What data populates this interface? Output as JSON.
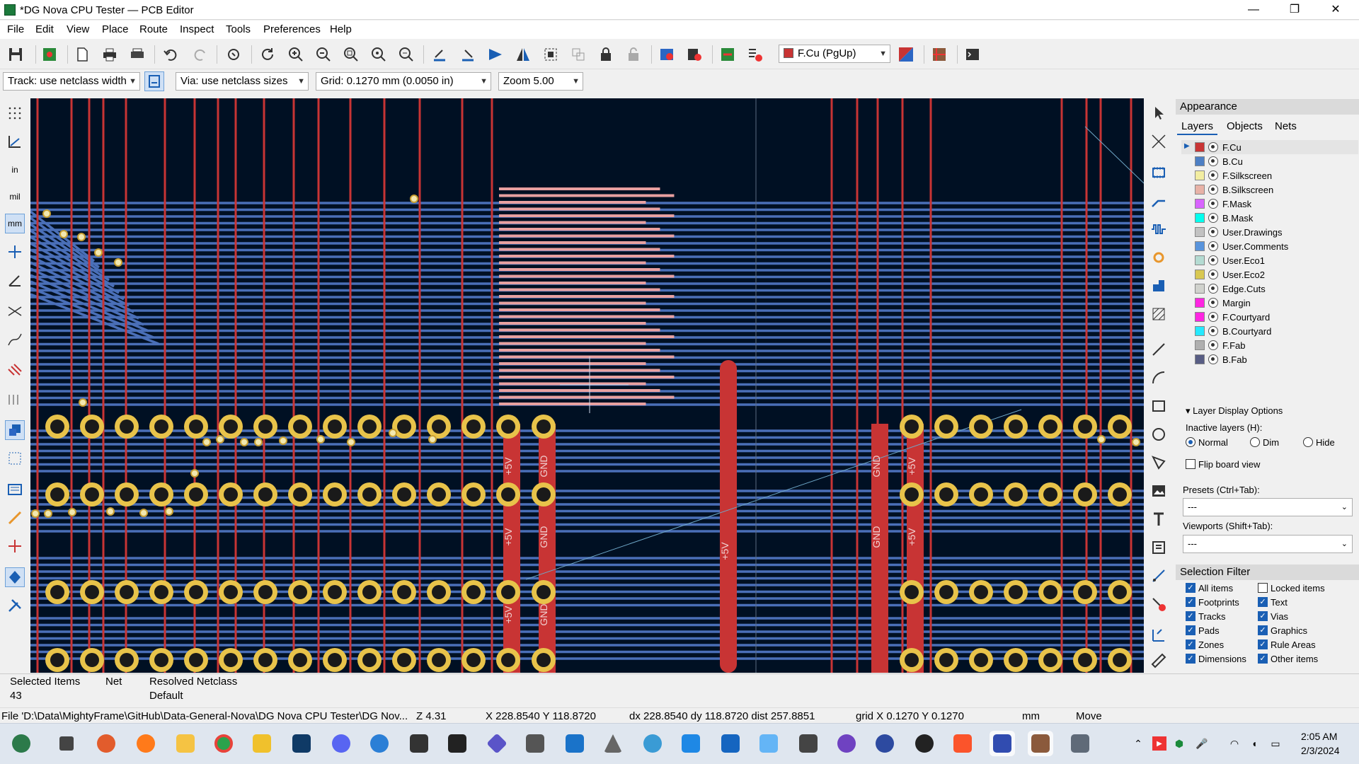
{
  "window": {
    "title": "*DG Nova CPU Tester — PCB Editor",
    "minimize": "—",
    "restore": "❐",
    "close": "✕"
  },
  "menu": [
    "File",
    "Edit",
    "View",
    "Place",
    "Route",
    "Inspect",
    "Tools",
    "Preferences",
    "Help"
  ],
  "toolbar": {
    "layer_select": "F.Cu (PgUp)",
    "layer_color": "#c83434"
  },
  "toolbar2": {
    "track": "Track: use netclass width",
    "via": "Via: use netclass sizes",
    "grid": "Grid: 0.1270 mm (0.0050 in)",
    "zoom": "Zoom 5.00"
  },
  "left_units": {
    "inch": "in",
    "mil": "mil",
    "mm": "mm"
  },
  "appearance": {
    "title": "Appearance",
    "tabs": [
      "Layers",
      "Objects",
      "Nets"
    ],
    "layers": [
      {
        "name": "F.Cu",
        "color": "#c83434"
      },
      {
        "name": "B.Cu",
        "color": "#4d7fc4"
      },
      {
        "name": "F.Silkscreen",
        "color": "#f2eda1"
      },
      {
        "name": "B.Silkscreen",
        "color": "#e8b2a7"
      },
      {
        "name": "F.Mask",
        "color": "#d864ff"
      },
      {
        "name": "B.Mask",
        "color": "#02ffee"
      },
      {
        "name": "User.Drawings",
        "color": "#c2c2c2"
      },
      {
        "name": "User.Comments",
        "color": "#5994dc"
      },
      {
        "name": "User.Eco1",
        "color": "#b4dbd2"
      },
      {
        "name": "User.Eco2",
        "color": "#d8c852"
      },
      {
        "name": "Edge.Cuts",
        "color": "#d0d2cd"
      },
      {
        "name": "Margin",
        "color": "#ff26e2"
      },
      {
        "name": "F.Courtyard",
        "color": "#ff26e2"
      },
      {
        "name": "B.Courtyard",
        "color": "#26e9ff"
      },
      {
        "name": "F.Fab",
        "color": "#afafaf"
      },
      {
        "name": "B.Fab",
        "color": "#585d84"
      }
    ],
    "layer_display_options": "Layer Display Options",
    "inactive_layers": "Inactive layers (H):",
    "inactive_options": [
      "Normal",
      "Dim",
      "Hide"
    ],
    "flip_board": "Flip board view",
    "presets_label": "Presets (Ctrl+Tab):",
    "presets_value": "---",
    "viewports_label": "Viewports (Shift+Tab):",
    "viewports_value": "---",
    "selection_filter": "Selection Filter",
    "filters_left": [
      "All items",
      "Footprints",
      "Tracks",
      "Pads",
      "Zones",
      "Dimensions"
    ],
    "filters_right": [
      "Locked items",
      "Text",
      "Vias",
      "Graphics",
      "Rule Areas",
      "Other items"
    ]
  },
  "canvas": {
    "pad_labels": [
      "+5V",
      "GND",
      "+5V",
      "GND",
      "+5V",
      "GND",
      "+5V",
      "GND",
      "+5V",
      "GND",
      "+5V"
    ]
  },
  "status": {
    "selected_label": "Selected Items",
    "selected_value": "43",
    "net_label": "Net",
    "netclass_label": "Resolved Netclass",
    "netclass_value": "Default"
  },
  "msgbar": {
    "file": "File 'D:\\Data\\MightyFrame\\GitHub\\Data-General-Nova\\DG Nova CPU Tester\\DG Nov...",
    "z": "Z 4.31",
    "xy": "X 228.8540  Y 118.8720",
    "dxy": "dx 228.8540  dy 118.8720  dist 257.8851",
    "grid": "grid X 0.1270  Y 0.1270",
    "units": "mm",
    "mode": "Move"
  },
  "clock": {
    "time": "2:05 AM",
    "date": "2/3/2024"
  }
}
